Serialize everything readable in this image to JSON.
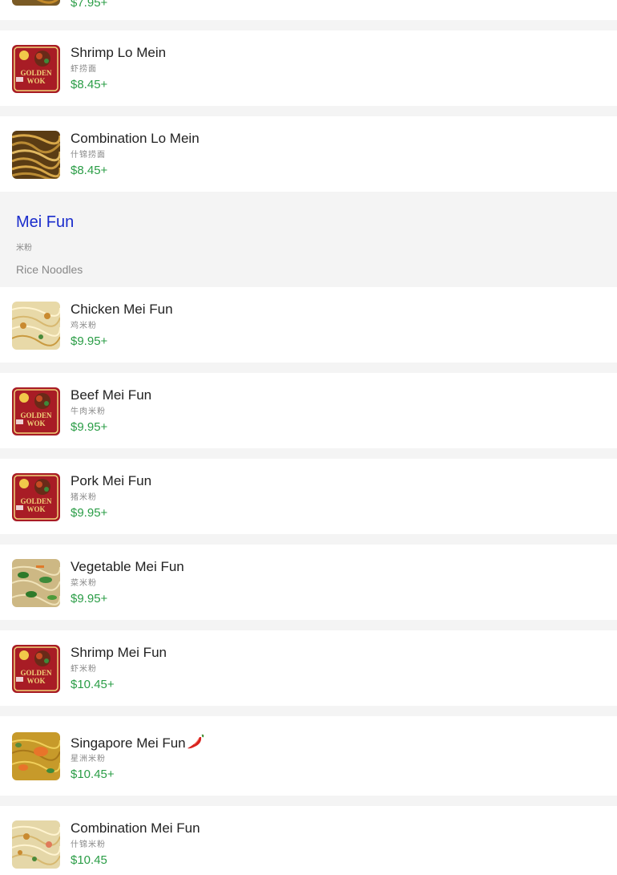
{
  "top_partial": {
    "price": "$7.95+"
  },
  "lo_mein_items": [
    {
      "name": "Shrimp Lo Mein",
      "cn": "虾捞面",
      "price": "$8.45+",
      "image": "golden-wok-logo"
    },
    {
      "name": "Combination Lo Mein",
      "cn": "什锦捞面",
      "price": "$8.45+",
      "image": "noodle-photo"
    }
  ],
  "section": {
    "title": "Mei Fun",
    "cn": "米粉",
    "description": "Rice Noodles"
  },
  "mei_fun_items": [
    {
      "name": "Chicken Mei Fun",
      "cn": "鸡米粉",
      "price": "$9.95+",
      "image": "rice-noodle-photo"
    },
    {
      "name": "Beef Mei Fun",
      "cn": "牛肉米粉",
      "price": "$9.95+",
      "image": "golden-wok-logo"
    },
    {
      "name": "Pork Mei Fun",
      "cn": "猪米粉",
      "price": "$9.95+",
      "image": "golden-wok-logo"
    },
    {
      "name": "Vegetable Mei Fun",
      "cn": "菜米粉",
      "price": "$9.95+",
      "image": "vegetable-photo"
    },
    {
      "name": "Shrimp Mei Fun",
      "cn": "虾米粉",
      "price": "$10.45+",
      "image": "golden-wok-logo"
    },
    {
      "name": "Singapore Mei Fun",
      "cn": "星洲米粉",
      "price": "$10.45+",
      "image": "curry-noodle-photo",
      "spicy": true,
      "spicy_icon": "chili-pepper-icon"
    },
    {
      "name": "Combination Mei Fun",
      "cn": "什锦米粉",
      "price": "$10.45",
      "image": "rice-noodle-photo"
    }
  ],
  "colors": {
    "price": "#2a9d46",
    "section_title": "#1a2ccc",
    "logo_red": "#a81c25"
  }
}
